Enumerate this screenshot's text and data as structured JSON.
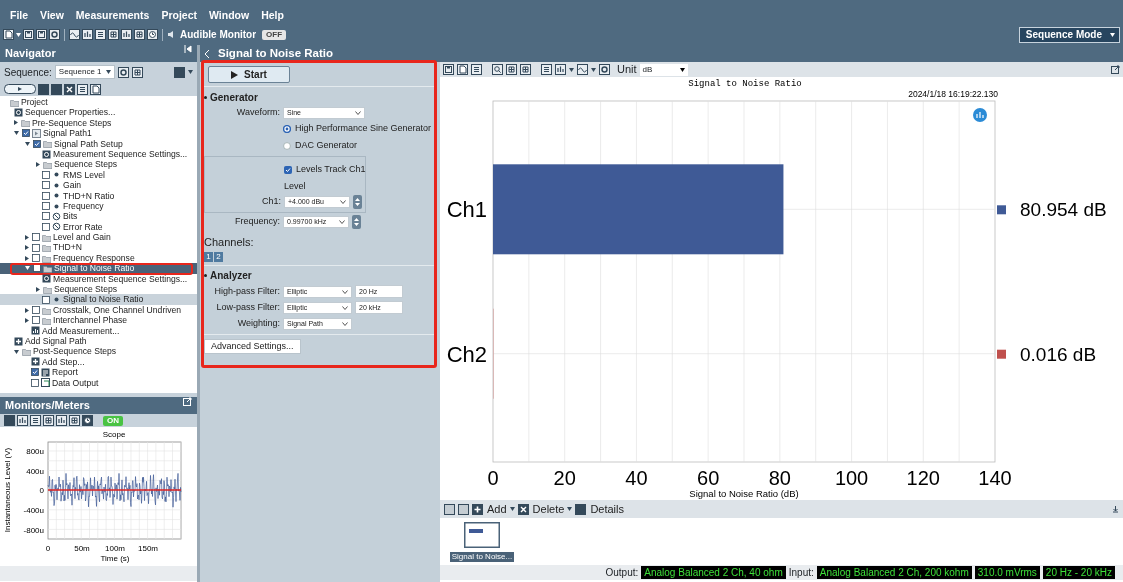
{
  "menu": [
    {
      "label": "File"
    },
    {
      "label": "View"
    },
    {
      "label": "Measurements"
    },
    {
      "label": "Project"
    },
    {
      "label": "Window"
    },
    {
      "label": "Help"
    }
  ],
  "toolbar": {
    "audible_monitor": {
      "label": "Audible Monitor",
      "switch_text": "OFF",
      "on": false
    },
    "mode_dropdown": {
      "value": "Sequence Mode"
    }
  },
  "navigator": {
    "title": "Navigator",
    "sequence_label": "Sequence:",
    "sequence_value": "Sequence 1",
    "tree": [
      {
        "label": "Project",
        "kind": "folder",
        "selected": false,
        "children": [
          {
            "label": "Sequencer Properties...",
            "kind": "gear",
            "selected": false
          },
          {
            "label": "Pre-Sequence Steps",
            "kind": "folder",
            "expanded": false,
            "selected": false
          },
          {
            "label": "Signal Path1",
            "kind": "path",
            "expanded": true,
            "checked": true,
            "selected": false,
            "children": [
              {
                "label": "Signal Path Setup",
                "kind": "folder",
                "expanded": true,
                "checked": true,
                "selected": false,
                "children": [
                  {
                    "label": "Measurement Sequence Settings...",
                    "kind": "gear",
                    "selected": false
                  },
                  {
                    "label": "Sequence Steps",
                    "kind": "folder",
                    "expanded": false,
                    "selected": false
                  },
                  {
                    "label": "RMS Level",
                    "kind": "dot",
                    "checked": false,
                    "selected": false
                  },
                  {
                    "label": "Gain",
                    "kind": "dot",
                    "checked": false,
                    "selected": false
                  },
                  {
                    "label": "THD+N Ratio",
                    "kind": "dot",
                    "checked": false,
                    "selected": false
                  },
                  {
                    "label": "Frequency",
                    "kind": "dot",
                    "checked": false,
                    "selected": false
                  },
                  {
                    "label": "Bits",
                    "kind": "blocked",
                    "checked": false,
                    "selected": false
                  },
                  {
                    "label": "Error Rate",
                    "kind": "blocked",
                    "checked": false,
                    "selected": false
                  }
                ]
              },
              {
                "label": "Level and Gain",
                "kind": "folder",
                "expanded": false,
                "checked": false,
                "selected": false
              },
              {
                "label": "THD+N",
                "kind": "folder",
                "expanded": false,
                "checked": false,
                "selected": false
              },
              {
                "label": "Frequency Response",
                "kind": "folder",
                "expanded": false,
                "checked": false,
                "selected": false
              },
              {
                "label": "Signal to Noise Ratio",
                "kind": "folder",
                "expanded": true,
                "checked": false,
                "selected": true,
                "annotated": true,
                "children": [
                  {
                    "label": "Measurement Sequence Settings...",
                    "kind": "gear",
                    "selected": false
                  },
                  {
                    "label": "Sequence Steps",
                    "kind": "folder",
                    "expanded": false,
                    "selected": false
                  },
                  {
                    "label": "Signal to Noise Ratio",
                    "kind": "dot",
                    "checked": false,
                    "selected": false,
                    "highlighted": true
                  }
                ]
              },
              {
                "label": "Crosstalk, One Channel Undriven",
                "kind": "folder",
                "expanded": false,
                "checked": false,
                "selected": false
              },
              {
                "label": "Interchannel Phase",
                "kind": "folder",
                "expanded": false,
                "checked": false,
                "selected": false
              },
              {
                "label": "Add Measurement...",
                "kind": "chart",
                "selected": false
              }
            ]
          },
          {
            "label": "Add Signal Path",
            "kind": "add",
            "selected": false
          },
          {
            "label": "Post-Sequence Steps",
            "kind": "folder",
            "expanded": true,
            "selected": false,
            "children": [
              {
                "label": "Add Step...",
                "kind": "add",
                "selected": false
              },
              {
                "label": "Report",
                "kind": "report",
                "checked": true,
                "selected": false
              },
              {
                "label": "Data Output",
                "kind": "output",
                "checked": false,
                "selected": false
              }
            ]
          }
        ]
      }
    ]
  },
  "monitors": {
    "title": "Monitors/Meters",
    "switch_text": "ON",
    "on": true,
    "scope": {
      "title": "Scope",
      "ylabel": "Instantaneous Level (V)",
      "yticks": [
        "800u",
        "400u",
        "0",
        "-400u",
        "-800u"
      ],
      "xlabel": "Time (s)",
      "xticks": [
        "0",
        "50m",
        "100m",
        "150m"
      ]
    }
  },
  "page": {
    "title": "Signal to Noise Ratio",
    "annotated": true,
    "start_label": "Start",
    "generator": {
      "title": "Generator",
      "waveform": {
        "label": "Waveform:",
        "value": "Sine"
      },
      "options": [
        {
          "label": "High Performance Sine Generator",
          "selected": true
        },
        {
          "label": "DAC Generator",
          "selected": false
        }
      ],
      "levels_track": {
        "label": "Levels Track Ch1",
        "checked": true
      },
      "level_heading": "Level",
      "ch1": {
        "label": "Ch1:",
        "value": "+4.000 dBu"
      },
      "frequency": {
        "label": "Frequency:",
        "value": "0.99700 kHz"
      }
    },
    "channels": {
      "label": "Channels:",
      "buttons": [
        "1",
        "2"
      ]
    },
    "analyzer": {
      "title": "Analyzer",
      "rows": [
        {
          "label": "High-pass Filter:",
          "value": "Elliptic",
          "text": "20 Hz"
        },
        {
          "label": "Low-pass Filter:",
          "value": "Elliptic",
          "text": "20 kHz"
        },
        {
          "label": "Weighting:",
          "value": "Signal Path"
        }
      ]
    },
    "advanced_button": "Advanced Settings..."
  },
  "result": {
    "unit_label": "Unit",
    "unit_value": "dB",
    "timestamp": "2024/1/18 16:19:22.130",
    "chart_data": {
      "type": "bar",
      "orientation": "horizontal",
      "title": "Signal to Noise Ratio",
      "xlabel": "Signal to Noise Ratio (dB)",
      "categories": [
        "Ch1",
        "Ch2"
      ],
      "series": [
        {
          "color": "#3f5a96",
          "values": [
            81,
            null
          ]
        },
        {
          "color": "#c0504d",
          "values": [
            null,
            0
          ]
        }
      ],
      "stacked": true,
      "grid": true,
      "xlim": [
        0,
        140
      ],
      "xticks": [
        0,
        20,
        40,
        60,
        80,
        100,
        120,
        140
      ],
      "value_labels": [
        "80.954 dB",
        "0.016 dB"
      ]
    }
  },
  "results_bar": {
    "buttons": [
      {
        "label": "Add",
        "kind": "add"
      },
      {
        "label": "Delete",
        "kind": "delete"
      },
      {
        "label": "Details",
        "kind": "details"
      }
    ],
    "thumbnails": [
      {
        "label": "Signal to Noise...",
        "selected": true
      }
    ]
  },
  "status_bar": {
    "output_label": "Output:",
    "output_value": "Analog Balanced 2 Ch, 40 ohm",
    "input_label": "Input:",
    "indicators": [
      "Analog Balanced 2 Ch, 200 kohm",
      "310.0 mVrms",
      "20 Hz - 20 kHz"
    ]
  }
}
